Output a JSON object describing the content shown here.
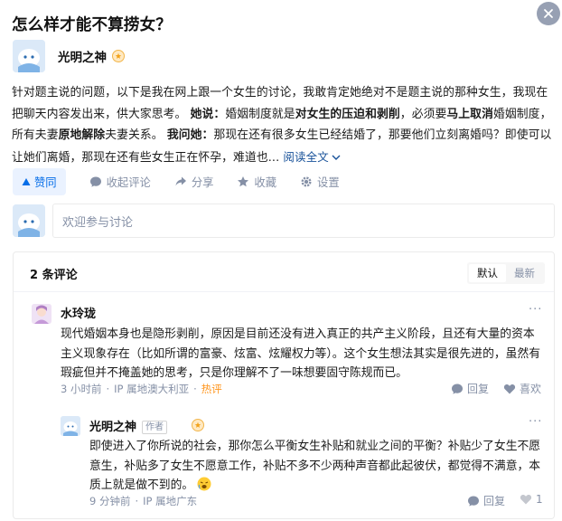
{
  "question": {
    "title": "怎么样才能不算捞女？"
  },
  "answer": {
    "author_name": "光明之神",
    "segments": [
      "针对题主说的问题，以下是我在网上跟一个女生的讨论，我敢肯定她绝对不是题主说的那种女生，我现在把聊天内容发出来，供大家思考。",
      "她说：",
      "婚姻制度就是",
      "对女生的压迫和剥削",
      "，必须要",
      "马上取消",
      "婚姻制度，所有夫妻",
      "原地解除",
      "夫妻关系。",
      "我问她：",
      "那现在还有很多女生已经结婚了，那要他们立刻离婚吗？即使可以让她们离婚，那现在还有些女生正在怀孕，难道也...",
      "阅读全文"
    ]
  },
  "actions": {
    "vote": "赞同",
    "comment": "收起评论",
    "share": "分享",
    "favorite": "收藏",
    "settings": "设置"
  },
  "compose": {
    "placeholder": "欢迎参与讨论"
  },
  "comments": {
    "count": "2 条评论",
    "sort_default": "默认",
    "sort_latest": "最新",
    "items": [
      {
        "name": "水玲珑",
        "text": "现代婚姻本身也是隐形剥削，原因是目前还没有进入真正的共产主义阶段，且还有大量的资本主义现象存在（比如所谓的富豪、炫富、炫耀权力等）。这个女生想法其实是很先进的，虽然有瑕疵但并不掩盖她的思考，只是你理解不了一味想要固守陈规而已。",
        "time": "3 小时前",
        "location": "IP 属地澳大利亚",
        "hot": "热评",
        "reply": "回复",
        "like": "喜欢"
      },
      {
        "name": "光明之神",
        "tag": "作者",
        "text": "即使进入了你所说的社会，那你怎么平衡女生补贴和就业之间的平衡？补贴少了女生不愿意生，补贴多了女生不愿意工作，补贴不多不少两种声音都此起彼伏，都觉得不满意，本质上就是做不到的。",
        "time": "9 分钟前",
        "location": "IP 属地广东",
        "reply": "回复",
        "like_count": "1"
      }
    ]
  },
  "colors": {
    "accent": "#056de8",
    "link": "#175199",
    "muted": "#8590a6",
    "hot": "#ff961e"
  }
}
